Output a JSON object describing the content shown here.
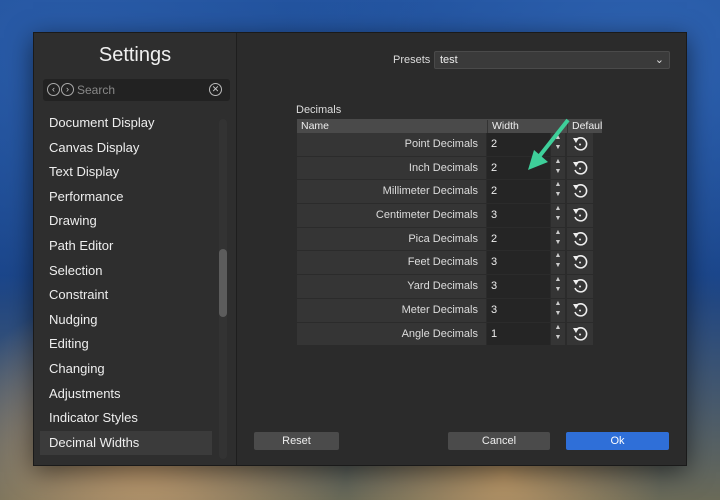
{
  "sidebar": {
    "title": "Settings",
    "search_placeholder": "Search",
    "items": [
      {
        "label": "Document Display"
      },
      {
        "label": "Canvas Display"
      },
      {
        "label": "Text Display"
      },
      {
        "label": "Performance"
      },
      {
        "label": "Drawing"
      },
      {
        "label": "Path Editor"
      },
      {
        "label": "Selection"
      },
      {
        "label": "Constraint"
      },
      {
        "label": "Nudging"
      },
      {
        "label": "Editing"
      },
      {
        "label": "Changing"
      },
      {
        "label": "Adjustments"
      },
      {
        "label": "Indicator Styles"
      },
      {
        "label": "Decimal Widths",
        "selected": true
      }
    ]
  },
  "presets": {
    "label": "Presets",
    "value": "test"
  },
  "decimals": {
    "section_label": "Decimals",
    "columns": {
      "name": "Name",
      "width": "Width",
      "default": "Default"
    },
    "rows": [
      {
        "name": "Point Decimals",
        "width": "2"
      },
      {
        "name": "Inch Decimals",
        "width": "2"
      },
      {
        "name": "Millimeter Decimals",
        "width": "2"
      },
      {
        "name": "Centimeter Decimals",
        "width": "3"
      },
      {
        "name": "Pica Decimals",
        "width": "2"
      },
      {
        "name": "Feet Decimals",
        "width": "3"
      },
      {
        "name": "Yard Decimals",
        "width": "3"
      },
      {
        "name": "Meter Decimals",
        "width": "3"
      },
      {
        "name": "Angle Decimals",
        "width": "1"
      }
    ]
  },
  "buttons": {
    "reset": "Reset",
    "cancel": "Cancel",
    "ok": "Ok"
  },
  "colors": {
    "accent": "#2f6fd8",
    "annotation_arrow": "#3ecf9a"
  }
}
